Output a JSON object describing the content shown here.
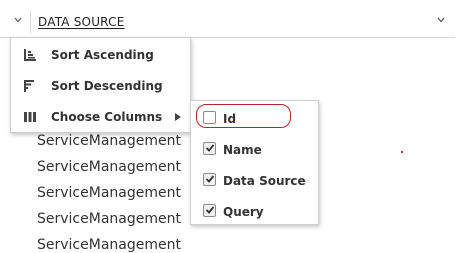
{
  "header": {
    "column_title": "DATA SOURCE"
  },
  "menu": {
    "items": [
      {
        "label": "Sort Ascending",
        "icon": "sort-ascending-icon"
      },
      {
        "label": "Sort Descending",
        "icon": "sort-descending-icon"
      },
      {
        "label": "Choose Columns",
        "icon": "columns-icon"
      }
    ]
  },
  "columns_submenu": {
    "items": [
      {
        "label": "Id",
        "checked": false
      },
      {
        "label": "Name",
        "checked": true
      },
      {
        "label": "Data Source",
        "checked": true
      },
      {
        "label": "Query",
        "checked": true
      }
    ]
  },
  "rows": [
    "ServiceManagement",
    "ServiceManagement",
    "ServiceManagement",
    "ServiceManagement",
    "ServiceManagement"
  ],
  "colors": {
    "highlight_ring": "#b3262b",
    "menu_border": "#cfcfcf"
  }
}
